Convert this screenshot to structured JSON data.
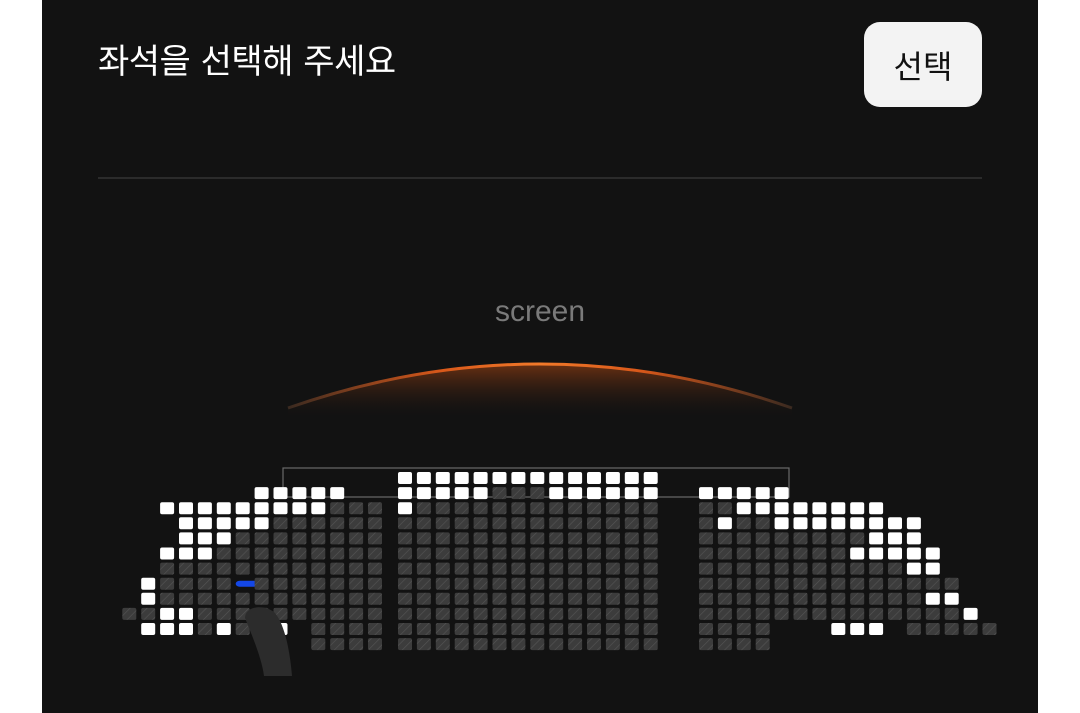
{
  "header": {
    "title": "좌석을 선택해 주세요",
    "select_button_label": "선택"
  },
  "screen": {
    "label": "screen"
  },
  "colors": {
    "background": "#121212",
    "seat_available": "#ffffff",
    "seat_unavailable": "#3c3c3c",
    "seat_selected": "#1447e6",
    "screen_glow": "#e8621a",
    "divider": "#2b2b2b"
  },
  "seat_map": {
    "legend": {
      "A": "available",
      "X": "unavailable",
      "S": "selected",
      ".": "empty"
    },
    "rows": [
      "...........|AAAAAAAAAAAAAA|.....",
      "....AAAAA..|AAAAAXXXAAAAAA|AAAAA",
      "AAAAAAAAAXXX|AXXXXXXXXXXXXX|XXAAAAAAAA",
      ".AAAAAXXXXXX|XXXXXXXXXXXXXX|XAXXAAAAAAAA",
      ".AAAXXXXXXXX|XXXXXXXXXXXXXX|XXXXXXXXXAAA",
      "AAAXXXXXXXXX|XXXXXXXXXXXXXX|XXXXXXXXAAAAA",
      "XXXXXXXXXXXX|XXXXXXXXXXXXXX|XXXXXXXXXXXAA",
      "AXXXXSXXXXXXX|XXXXXXXXXXXXXX|XXXXXXXXXXXXXX",
      "AXXXXXXXXXXXX|XXXXXXXXXXXXXX|XXXXXXXXXXXXAA",
      "XXAAXXXXXXXXXX|XXXXXXXXXXXXXX|XXXXXXXXXXXXXXA",
      "AAAXAX.A.XXXX|XXXXXXXXXXXXXX|XXXX...AAA.XXXXX",
      ".......XXXX|XXXXXXXXXXXXXX|XXXX"
    ]
  }
}
